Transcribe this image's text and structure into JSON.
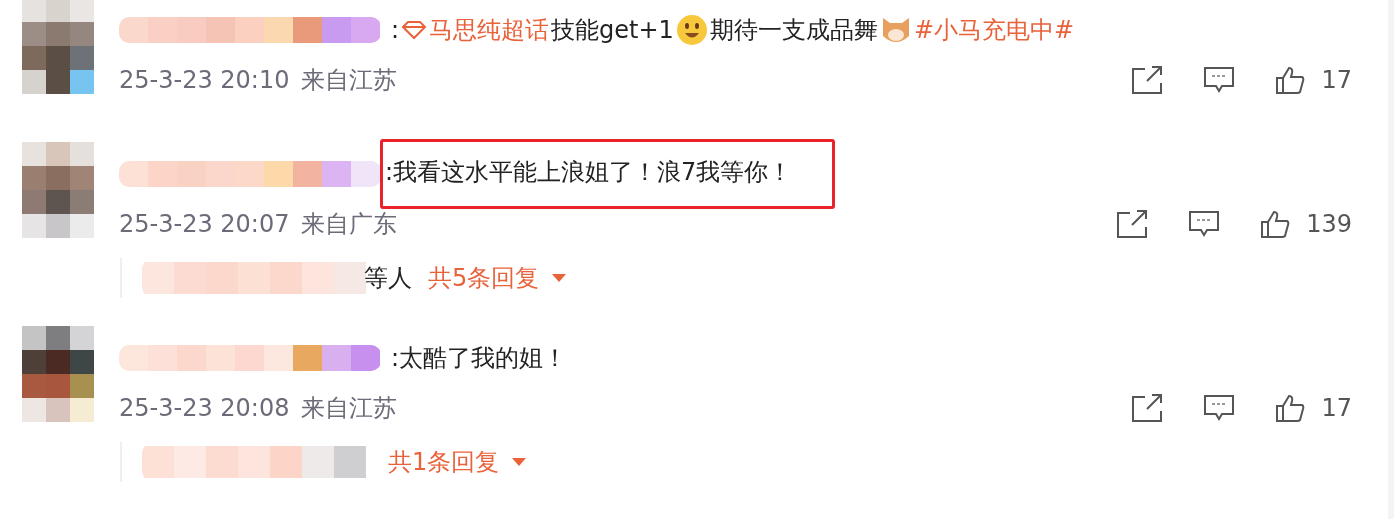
{
  "comments": [
    {
      "highlighted": false,
      "segments": [
        {
          "kind": "text",
          "text": ":"
        },
        {
          "kind": "gem"
        },
        {
          "kind": "link",
          "text": "马思纯超话"
        },
        {
          "kind": "text",
          "text": " 技能get+1"
        },
        {
          "kind": "emoji"
        },
        {
          "kind": "text",
          "text": "期待一支成品舞"
        },
        {
          "kind": "cat"
        },
        {
          "kind": "link",
          "text": "#小马充电中#"
        }
      ],
      "time": "25-3-23 20:10",
      "location": "来自江苏",
      "likes": "17"
    },
    {
      "highlighted": true,
      "segments": [
        {
          "kind": "text",
          "text": ":我看这水平能上浪姐了！浪7我等你！"
        }
      ],
      "time": "25-3-23 20:07",
      "location": "来自广东",
      "likes": "139",
      "replies": {
        "suffix": "等人",
        "count": "共5条回复"
      }
    },
    {
      "highlighted": false,
      "segments": [
        {
          "kind": "text",
          "text": ":太酷了我的姐！"
        }
      ],
      "time": "25-3-23 20:08",
      "location": "来自江苏",
      "likes": "17",
      "replies": {
        "count": "共1条回复"
      }
    }
  ]
}
